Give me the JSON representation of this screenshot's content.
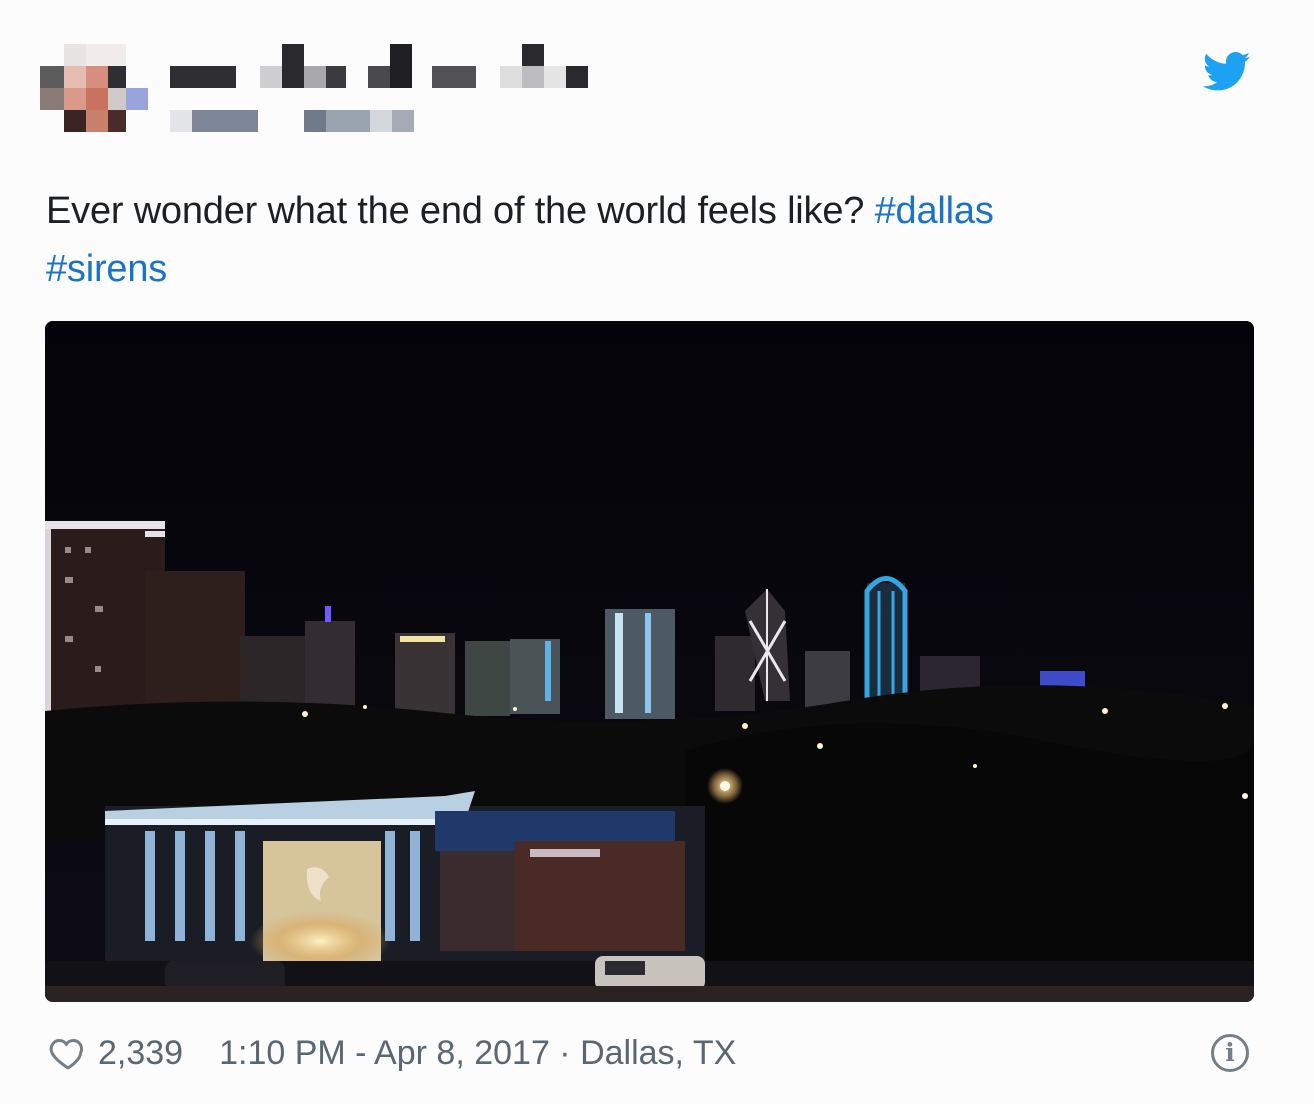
{
  "tweet": {
    "text_main": "Ever wonder what the end of the world feels like? ",
    "hashtags": [
      "#dallas",
      "#sirens"
    ]
  },
  "media": {
    "kind": "video-thumbnail"
  },
  "footer": {
    "likes": "2,339",
    "timestamp": "1:10 PM - Apr 8, 2017",
    "separator": " · ",
    "location": "Dallas, TX"
  },
  "icons": {
    "brand": "twitter-bird-icon",
    "like": "heart-icon",
    "info": "info-icon",
    "info_glyph": "i"
  },
  "colors": {
    "brand": "#1da1f2",
    "hashtag": "#1b73c9",
    "meta": "#596773"
  }
}
